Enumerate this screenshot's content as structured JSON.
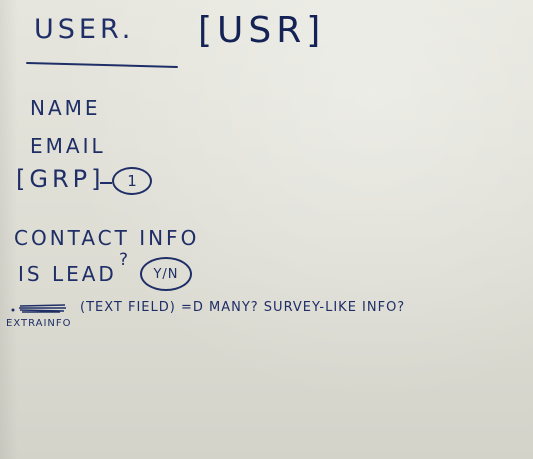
{
  "sketch": {
    "title": "USER.",
    "title_tag": "[USR]",
    "fields": {
      "name": "NAME",
      "email": "EMAIL",
      "group": "[GRP]",
      "group_cardinality": "1",
      "contact_info": "CONTACT INFO",
      "is_lead": "IS LEAD",
      "is_lead_question": "?",
      "is_lead_value": "Y/N",
      "extra_label": "EXTRAINFO",
      "extra_note": "(TEXT FIELD) =D MANY? SURVEY-LIKE INFO?"
    },
    "ink_color": "#1f2e66",
    "paper_color": "#dcdcd3"
  }
}
